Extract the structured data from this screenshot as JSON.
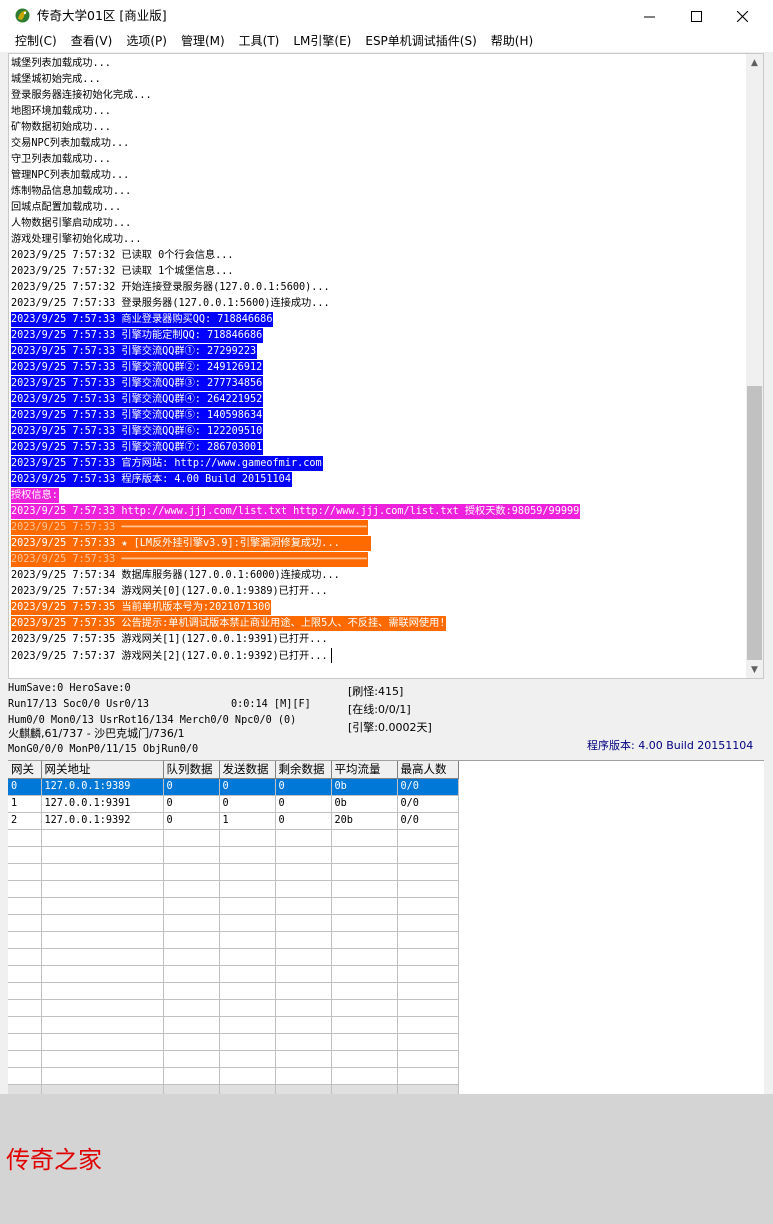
{
  "window": {
    "title": "传奇大学01区 [商业版]",
    "minimize_glyph": "—",
    "maximize_glyph": "□",
    "close_glyph": "✕",
    "icon": "dragon-app-icon"
  },
  "menu": [
    {
      "label": "控制(C)"
    },
    {
      "label": "查看(V)"
    },
    {
      "label": "选项(P)"
    },
    {
      "label": "管理(M)"
    },
    {
      "label": "工具(T)"
    },
    {
      "label": "LM引擎(E)"
    },
    {
      "label": "ESP单机调试插件(S)"
    },
    {
      "label": "帮助(H)"
    }
  ],
  "log": {
    "lines": [
      {
        "text": "城堡列表加载成功...",
        "style": ""
      },
      {
        "text": "城堡城初始完成...",
        "style": ""
      },
      {
        "text": "登录服务器连接初始化完成...",
        "style": ""
      },
      {
        "text": "地图环境加载成功...",
        "style": ""
      },
      {
        "text": "矿物数据初始成功...",
        "style": ""
      },
      {
        "text": "交易NPC列表加载成功...",
        "style": ""
      },
      {
        "text": "守卫列表加载成功...",
        "style": ""
      },
      {
        "text": "管理NPC列表加载成功...",
        "style": ""
      },
      {
        "text": "炼制物品信息加载成功...",
        "style": ""
      },
      {
        "text": "回城点配置加载成功...",
        "style": ""
      },
      {
        "text": "人物数据引擎启动成功...",
        "style": ""
      },
      {
        "text": "游戏处理引擎初始化成功...",
        "style": ""
      },
      {
        "text": "2023/9/25 7:57:32 已读取 0个行会信息...",
        "style": ""
      },
      {
        "text": "2023/9/25 7:57:32 已读取 1个城堡信息...",
        "style": ""
      },
      {
        "text": "2023/9/25 7:57:32 开始连接登录服务器(127.0.0.1:5600)...",
        "style": ""
      },
      {
        "text": "2023/9/25 7:57:33 登录服务器(127.0.0.1:5600)连接成功...",
        "style": ""
      },
      {
        "text": "2023/9/25 7:57:33 商业登录器购买QQ: 718846686",
        "style": "hl-blue"
      },
      {
        "text": "2023/9/25 7:57:33 引擎功能定制QQ: 718846686",
        "style": "hl-blue"
      },
      {
        "text": "2023/9/25 7:57:33 引擎交流QQ群①: 27299223",
        "style": "hl-blue"
      },
      {
        "text": "2023/9/25 7:57:33 引擎交流QQ群②: 249126912",
        "style": "hl-blue"
      },
      {
        "text": "2023/9/25 7:57:33 引擎交流QQ群③: 277734856",
        "style": "hl-blue"
      },
      {
        "text": "2023/9/25 7:57:33 引擎交流QQ群④: 264221952",
        "style": "hl-blue"
      },
      {
        "text": "2023/9/25 7:57:33 引擎交流QQ群⑤: 140598634",
        "style": "hl-blue"
      },
      {
        "text": "2023/9/25 7:57:33 引擎交流QQ群⑥: 122209510",
        "style": "hl-blue"
      },
      {
        "text": "2023/9/25 7:57:33 引擎交流QQ群⑦: 286703001",
        "style": "hl-blue"
      },
      {
        "text": "2023/9/25 7:57:33 官方网站: http://www.gameofmir.com",
        "style": "hl-blue"
      },
      {
        "text": "2023/9/25 7:57:33 程序版本: 4.00 Build 20151104",
        "style": "hl-blue"
      },
      {
        "text": "授权信息:",
        "style": "hl-magenta"
      },
      {
        "text": "2023/9/25 7:57:33 http://www.jjj.com/list.txt http://www.jjj.com/list.txt 授权天数:98059/99999",
        "style": "hl-magenta"
      },
      {
        "text": "2023/9/25 7:57:33 ━━━━━━━━━━━━━━━━━━━━━━━━━━━━━━━━━━━━━━━━",
        "style": "hl-orange-dim"
      },
      {
        "text": "2023/9/25 7:57:33 ★ [LM反外挂引擎v3.9]:引擎漏洞修复成功...     ",
        "style": "hl-orange"
      },
      {
        "text": "2023/9/25 7:57:33 ━━━━━━━━━━━━━━━━━━━━━━━━━━━━━━━━━━━━━━━━",
        "style": "hl-orange-dim"
      },
      {
        "text": "2023/9/25 7:57:34 数据库服务器(127.0.0.1:6000)连接成功...",
        "style": ""
      },
      {
        "text": "2023/9/25 7:57:34 游戏网关[0](127.0.0.1:9389)已打开...",
        "style": ""
      },
      {
        "text": "2023/9/25 7:57:35 当前单机版本号为:2021071300",
        "style": "hl-orange"
      },
      {
        "text": "2023/9/25 7:57:35 公告提示:单机调试版本禁止商业用途、上限5人、不反挂、需联网使用!",
        "style": "hl-orange"
      },
      {
        "text": "2023/9/25 7:57:35 游戏网关[1](127.0.0.1:9391)已打开...",
        "style": ""
      },
      {
        "text": "2023/9/25 7:57:37 游戏网关[2](127.0.0.1:9392)已打开...",
        "style": "caret"
      }
    ]
  },
  "status": {
    "save": "HumSave:0 HeroSave:0",
    "run": "Run17/13 Soc0/0 Usr0/13",
    "time": "0:0:14 [M][F]",
    "hum": "Hum0/0 Mon0/13 UsrRot16/134 Merch0/0 Npc0/0 (0)",
    "map": "火麒麟,61/737 - 沙巴克城门/736/1",
    "mon": "MonG0/0/0 MonP0/11/15 ObjRun0/0",
    "refresh": "[刷怪:415]",
    "online": "[在线:0/0/1]",
    "engine": "[引擎:0.0002天]",
    "version": "程序版本: 4.00 Build 20151104"
  },
  "gateway_table": {
    "columns": [
      "网关",
      "网关地址",
      "队列数据",
      "发送数据",
      "剩余数据",
      "平均流量",
      "最高人数"
    ],
    "rows": [
      [
        "0",
        "127.0.0.1:9389",
        "0",
        "0",
        "0",
        "0b",
        "0/0"
      ],
      [
        "1",
        "127.0.0.1:9391",
        "0",
        "0",
        "0",
        "0b",
        "0/0"
      ],
      [
        "2",
        "127.0.0.1:9392",
        "0",
        "1",
        "0",
        "20b",
        "0/0"
      ]
    ]
  },
  "watermark": "传奇之家",
  "colors": {
    "highlight_blue": "#0000ff",
    "highlight_magenta": "#ee22dd",
    "highlight_orange": "#ff6a00",
    "selection": "#0078d7",
    "watermark": "#e00000"
  }
}
